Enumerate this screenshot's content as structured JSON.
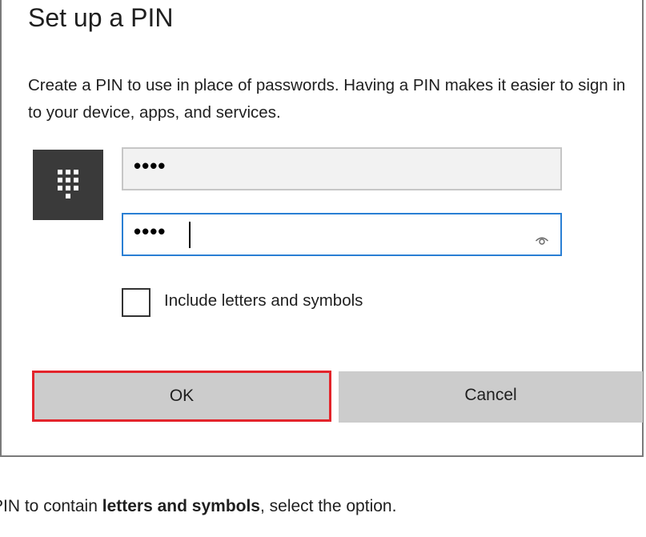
{
  "dialog": {
    "title": "Set up a PIN",
    "description": "Create a PIN to use in place of passwords. Having a PIN makes it easier to sign in to your device, apps, and services.",
    "pin_value": "••••",
    "confirm_value": "••••",
    "checkbox_label": "Include letters and symbols",
    "checkbox_checked": false,
    "ok_label": "OK",
    "cancel_label": "Cancel",
    "highlight_color": "#e3242b",
    "focus_color": "#2a7fd4",
    "icons": [
      "keypad-icon",
      "reveal-password-eye-icon"
    ]
  },
  "caption": {
    "prefix": "PIN to contain ",
    "bold": "letters and symbols",
    "suffix": ", select the option."
  }
}
